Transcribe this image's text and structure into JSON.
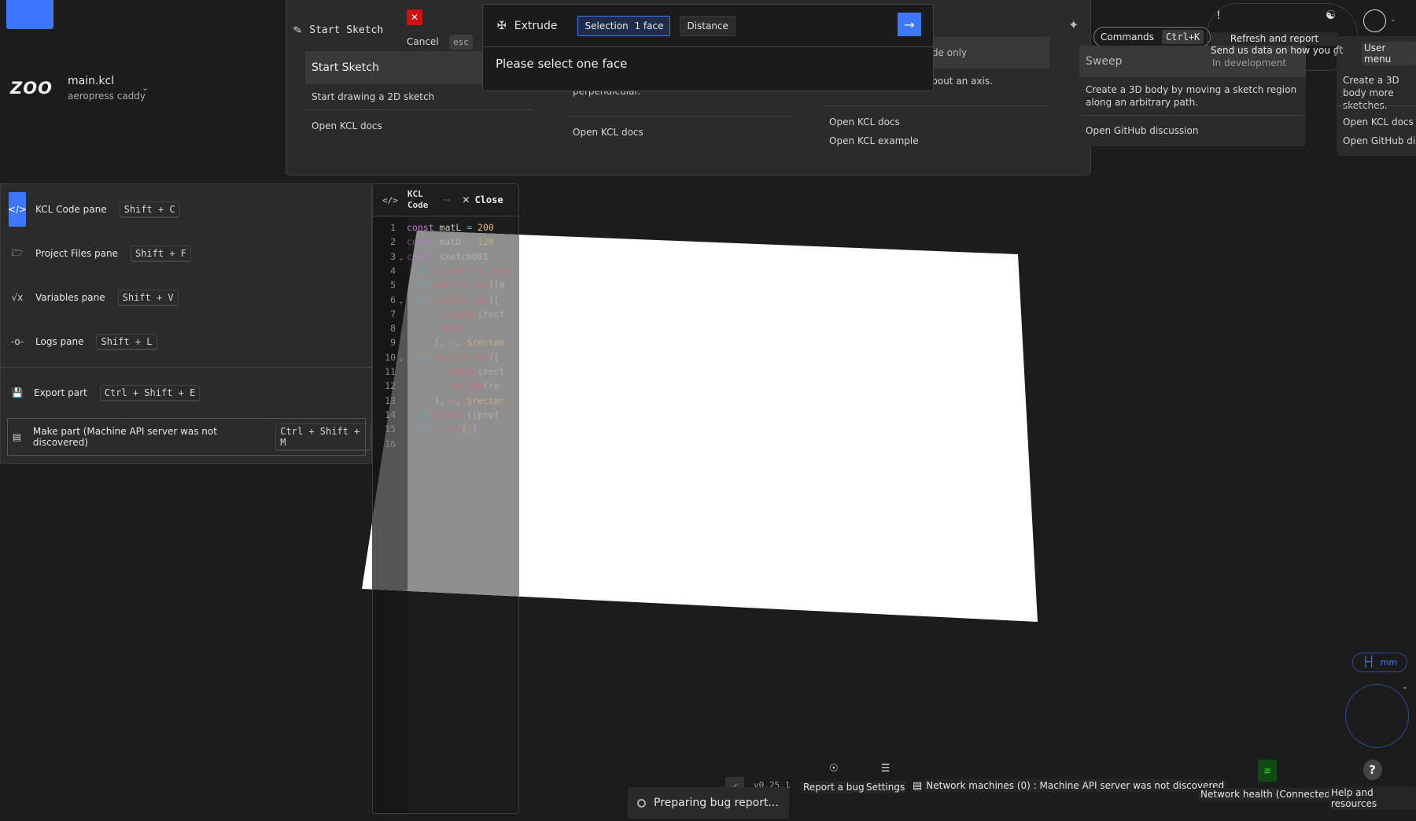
{
  "app": {
    "brand": "ZOO",
    "file_name": "main.kcl",
    "project_name": "aeropress caddy",
    "accent_color": "#3d76ff"
  },
  "toolbar": {
    "start_sketch_label": "Start Sketch",
    "cancel_label": "Cancel",
    "cancel_shortcut": "esc",
    "tooltips": {
      "start_sketch": {
        "title": "Start Sketch",
        "description": "Start drawing a 2D sketch",
        "links": [
          "Open KCL docs"
        ]
      },
      "extrude": {
        "description": "perpendicular.",
        "links": [
          "Open KCL docs"
        ]
      },
      "revolve": {
        "badge": "KCL code only",
        "description": "ting a sketch region about an axis.",
        "links": [
          "Open KCL docs",
          "Open KCL example"
        ]
      },
      "sweep": {
        "title": "Sweep",
        "status": "In development",
        "description": "Create a 3D body by moving a sketch region along an arbitrary path.",
        "links": [
          "Open GitHub discussion"
        ]
      },
      "loft": {
        "title_fragment": "ft",
        "description": "Create a 3D body more sketches.",
        "links": [
          "Open KCL docs",
          "Open GitHub disc"
        ]
      }
    }
  },
  "command_bar": {
    "command": "Extrude",
    "args": [
      {
        "label": "Selection",
        "value": "1 face",
        "active": true
      },
      {
        "label": "Distance",
        "value": "",
        "active": false
      }
    ],
    "message": "Please select one face",
    "submit_icon": "arrow-right-icon"
  },
  "header_right": {
    "commands_label": "Commands",
    "commands_shortcut": "Ctrl+K",
    "refresh_tooltip_title": "Refresh and report",
    "refresh_tooltip_sub": "Send us data on how you got stuck",
    "warning_glyph": "!",
    "user_menu_tooltip": "User menu"
  },
  "pane_menu": {
    "items": [
      {
        "label": "KCL Code pane",
        "shortcut": "Shift + C",
        "icon": "code-icon",
        "active": true
      },
      {
        "label": "Project Files pane",
        "shortcut": "Shift + F",
        "icon": "folder-icon",
        "active": false
      },
      {
        "label": "Variables pane",
        "shortcut": "Shift + V",
        "icon": "sqrt-x-icon",
        "active": false
      },
      {
        "label": "Logs pane",
        "shortcut": "Shift + L",
        "icon": "logs-icon",
        "active": false
      }
    ],
    "actions": [
      {
        "label": "Export part",
        "shortcut": "Ctrl + Shift + E",
        "icon": "export-icon"
      },
      {
        "label": "Make part (Machine API server was not discovered)",
        "shortcut": "Ctrl + Shift + M",
        "icon": "machine-icon"
      }
    ]
  },
  "code_pane": {
    "title_line1": "KCL",
    "title_line2": "Code",
    "more_label": "⋯",
    "close_label": "Close",
    "lines": [
      {
        "n": "1",
        "fold": false,
        "tokens": [
          [
            "kw",
            "const"
          ],
          [
            "id",
            " matL "
          ],
          [
            "op",
            "="
          ],
          [
            "num",
            " 200"
          ]
        ]
      },
      {
        "n": "2",
        "fold": false,
        "tokens": [
          [
            "kw",
            "const"
          ],
          [
            "id",
            " matD "
          ],
          [
            "op",
            "="
          ],
          [
            "num",
            " 120"
          ]
        ]
      },
      {
        "n": "3",
        "fold": true,
        "tokens": [
          [
            "kw",
            "const"
          ],
          [
            "id",
            " sketch001 "
          ],
          [
            "op",
            "="
          ]
        ]
      },
      {
        "n": "4",
        "fold": false,
        "tokens": [
          [
            "id",
            "  "
          ],
          [
            "pipe",
            "|>"
          ],
          [
            "fn",
            " startProfileAt"
          ]
        ]
      },
      {
        "n": "5",
        "fold": false,
        "tokens": [
          [
            "id",
            "  "
          ],
          [
            "pipe",
            "|>"
          ],
          [
            "fn",
            " angledLine"
          ],
          [
            "id",
            "([0"
          ]
        ]
      },
      {
        "n": "6",
        "fold": true,
        "tokens": [
          [
            "id",
            "  "
          ],
          [
            "pipe",
            "|>"
          ],
          [
            "fn",
            " angledLine"
          ],
          [
            "id",
            "(["
          ]
        ]
      },
      {
        "n": "7",
        "fold": false,
        "tokens": [
          [
            "id",
            "       "
          ],
          [
            "fn",
            "segAng"
          ],
          [
            "id",
            "(rect"
          ]
        ]
      },
      {
        "n": "8",
        "fold": false,
        "tokens": [
          [
            "id",
            "       "
          ],
          [
            "fn",
            "matD"
          ]
        ]
      },
      {
        "n": "9",
        "fold": false,
        "tokens": [
          [
            "id",
            "     ], "
          ],
          [
            "pct",
            "%"
          ],
          [
            "id",
            ", "
          ],
          [
            "num",
            "$rectan"
          ]
        ]
      },
      {
        "n": "10",
        "fold": true,
        "tokens": [
          [
            "id",
            "  "
          ],
          [
            "pipe",
            "|>"
          ],
          [
            "fn",
            " angledLine"
          ],
          [
            "id",
            "(["
          ]
        ]
      },
      {
        "n": "11",
        "fold": false,
        "tokens": [
          [
            "id",
            "       "
          ],
          [
            "fn",
            "segAng"
          ],
          [
            "id",
            "(rect"
          ]
        ]
      },
      {
        "n": "12",
        "fold": false,
        "tokens": [
          [
            "id",
            "       "
          ],
          [
            "op",
            "-"
          ],
          [
            "fn",
            "segLen"
          ],
          [
            "id",
            "(re"
          ]
        ]
      },
      {
        "n": "13",
        "fold": false,
        "tokens": [
          [
            "id",
            "     ], "
          ],
          [
            "pct",
            "%"
          ],
          [
            "id",
            ", "
          ],
          [
            "num",
            "$rectan"
          ]
        ]
      },
      {
        "n": "14",
        "fold": false,
        "tokens": [
          [
            "id",
            "  "
          ],
          [
            "pipe",
            "|>"
          ],
          [
            "fn",
            " lineTo"
          ],
          [
            "id",
            "([prof"
          ]
        ]
      },
      {
        "n": "15",
        "fold": false,
        "tokens": [
          [
            "id",
            "  "
          ],
          [
            "pipe",
            "|>"
          ],
          [
            "fn",
            " close"
          ],
          [
            "id",
            "("
          ],
          [
            "pct",
            "%"
          ],
          [
            "id",
            ")"
          ]
        ]
      },
      {
        "n": "16",
        "fold": false,
        "tokens": []
      }
    ]
  },
  "viewport": {
    "units": "mm",
    "plane_color": "#ffffff"
  },
  "status_bar": {
    "version": "v0.25.1",
    "toast": "Preparing bug report...",
    "report_bug": "Report a bug",
    "settings": "Settings",
    "network_machines": "Network machines (0) : Machine API server was not discovered",
    "network_health": "Network health (Connected)",
    "network_health_color": "#2ec02e",
    "help": "Help and resources"
  }
}
